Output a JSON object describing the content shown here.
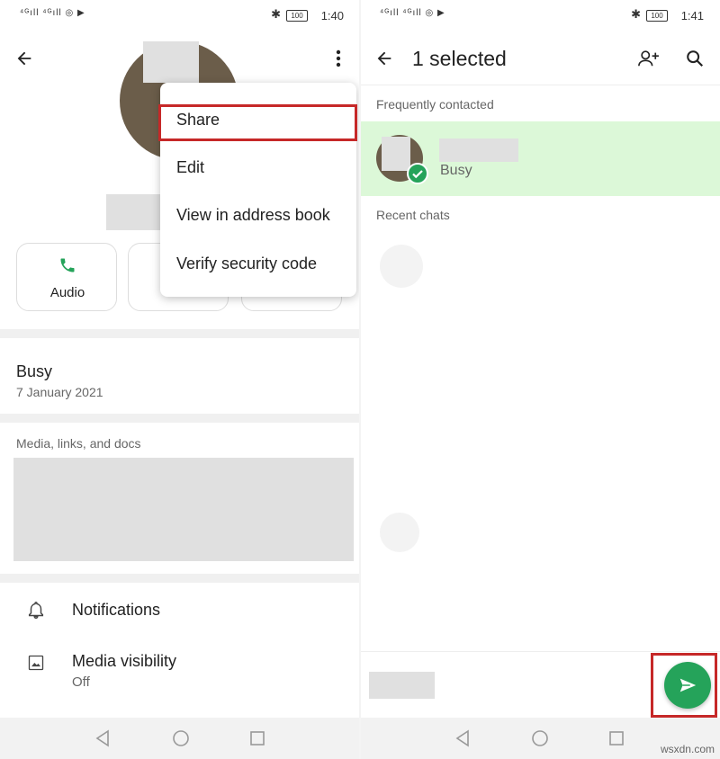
{
  "left": {
    "status": {
      "time": "1:40",
      "battery": "100"
    },
    "menu": [
      "Share",
      "Edit",
      "View in address book",
      "Verify security code"
    ],
    "actions": {
      "audio": "Audio"
    },
    "about": {
      "status": "Busy",
      "date": "7 January 2021"
    },
    "media": {
      "label": "Media, links, and docs"
    },
    "settings": {
      "notifications": "Notifications",
      "media_visibility": "Media visibility",
      "media_visibility_value": "Off"
    }
  },
  "right": {
    "status": {
      "time": "1:41",
      "battery": "100"
    },
    "header": {
      "title": "1 selected"
    },
    "sections": {
      "frequent": "Frequently contacted",
      "recent": "Recent chats"
    },
    "contact": {
      "status": "Busy"
    }
  },
  "colors": {
    "accent": "#25a35a",
    "highlight": "#dcf8d8",
    "red": "#c62828"
  },
  "watermark": "wsxdn.com"
}
